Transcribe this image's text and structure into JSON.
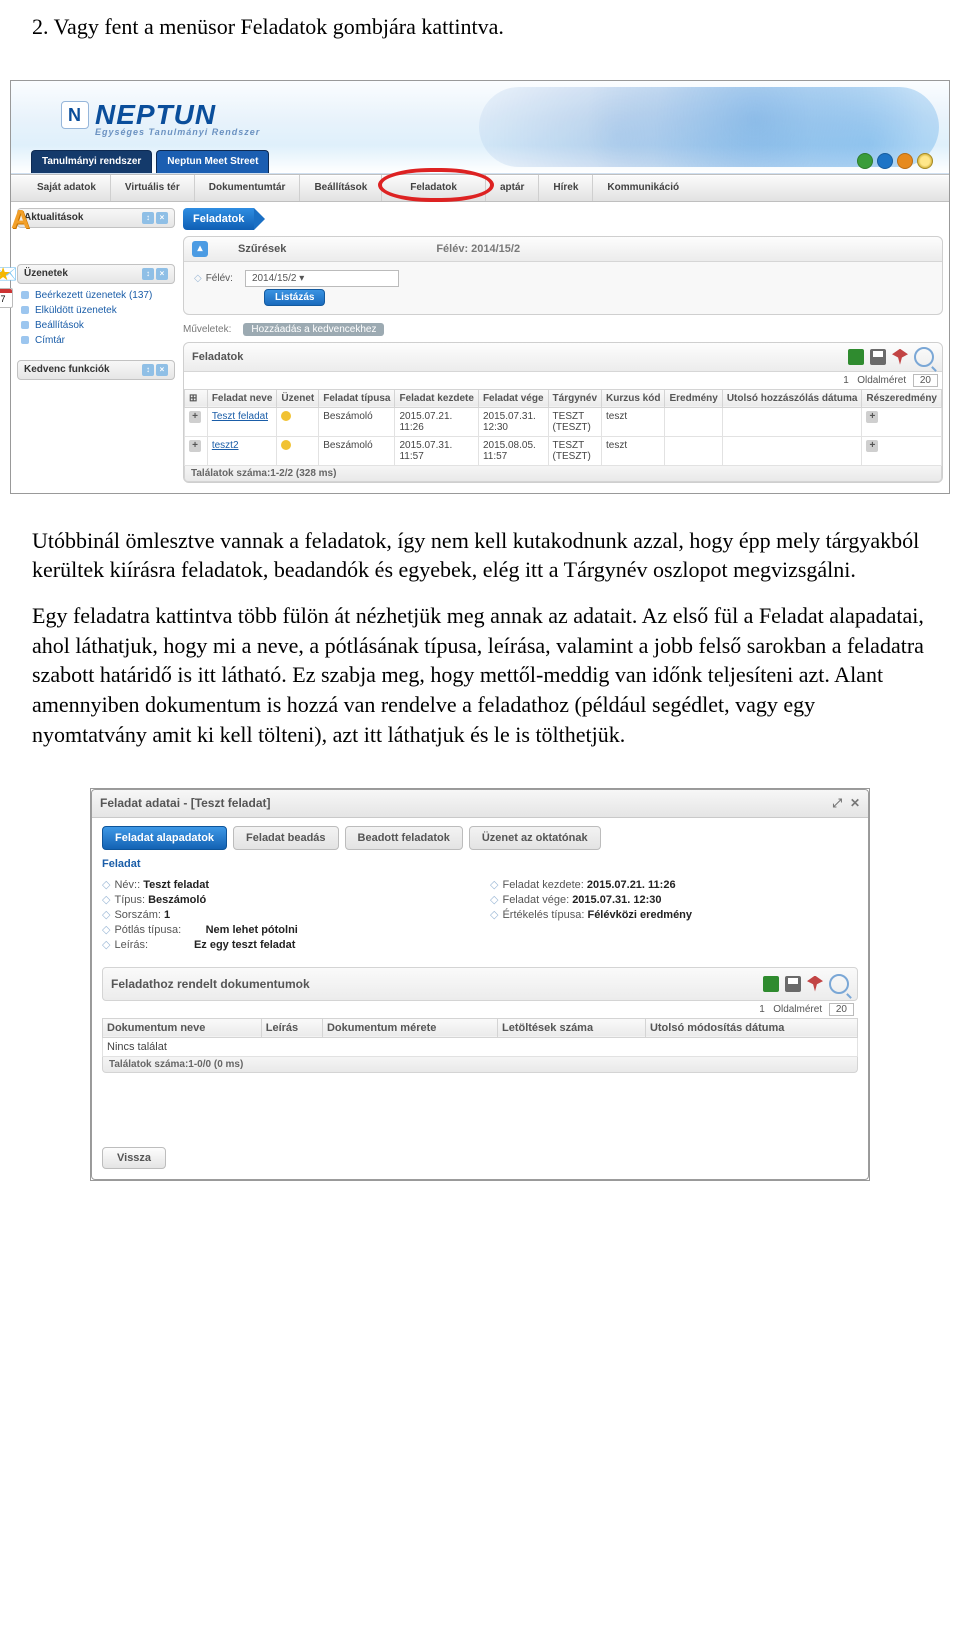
{
  "doc": {
    "heading": "2. Vagy fent a menüsor Feladatok gombjára kattintva.",
    "p1": "Utóbbinál ömlesztve vannak a feladatok, így nem kell kutakodnunk azzal, hogy épp mely tárgyakból kerültek kiírásra feladatok, beadandók és egyebek, elég itt a Tárgynév oszlopot megvizsgálni.",
    "p2": "Egy feladatra kattintva több fülön át nézhetjük meg annak az adatait. Az első fül a Feladat alapadatai, ahol láthatjuk, hogy mi a neve, a pótlásának típusa, leírása, valamint a jobb felső sarokban a feladatra szabott határidő is itt látható. Ez szabja meg, hogy mettől-meddig van időnk teljesíteni azt. Alant amennyiben dokumentum is hozzá van rendelve a feladathoz (például segédlet, vagy egy nyomtatvány amit ki kell tölteni), azt itt láthatjuk és le is tölthetjük."
  },
  "neptun": {
    "brand": "NEPTUN",
    "brand_sub": "Egységes Tanulmányi Rendszer",
    "top_tabs": [
      "Tanulmányi rendszer",
      "Neptun Meet Street"
    ],
    "menu": [
      "Saját adatok",
      "Virtuális tér",
      "Dokumentumtár",
      "Beállítások",
      "Feladatok",
      "aptár",
      "Hírek",
      "Kommunikáció"
    ],
    "side": {
      "akt": "Aktualitások",
      "uzen": "Üzenetek",
      "uzen_items": [
        "Beérkezett üzenetek (137)",
        "Elküldött üzenetek",
        "Beállítások",
        "Címtár"
      ],
      "fav": "Kedvenc funkciók",
      "cal_day": "7"
    },
    "main": {
      "crumb": "Feladatok",
      "filter_title": "Szűrések",
      "filter_right": "Félév: 2014/15/2",
      "felev_label": "Félév:",
      "felev_value": "2014/15/2",
      "list_btn": "Listázás",
      "ops_label": "Műveletek:",
      "ops_link": "Hozzáadás a kedvencekhez",
      "grid_title": "Feladatok",
      "page_size_label": "Oldalméret",
      "page_size_value": "20",
      "page_indicator": "1",
      "columns": [
        "",
        "Feladat neve",
        "Üzenet",
        "Feladat típusa",
        "Feladat kezdete",
        "Feladat vége",
        "Tárgynév",
        "Kurzus kód",
        "Eredmény",
        "Utolsó hozzászólás dátuma",
        "Részeredmény"
      ],
      "rows": [
        {
          "name": "Teszt feladat",
          "type": "Beszámoló",
          "start": "2015.07.21. 11:26",
          "end": "2015.07.31. 12:30",
          "subj": "TESZT (TESZT)",
          "course": "teszt"
        },
        {
          "name": "teszt2",
          "type": "Beszámoló",
          "start": "2015.07.31. 11:57",
          "end": "2015.08.05. 11:57",
          "subj": "TESZT (TESZT)",
          "course": "teszt"
        }
      ],
      "results": "Találatok száma:1-2/2 (328 ms)"
    }
  },
  "detail": {
    "title": "Feladat adatai - [Teszt feladat]",
    "tabs": [
      "Feladat alapadatok",
      "Feladat beadás",
      "Beadott feladatok",
      "Üzenet az oktatónak"
    ],
    "section": "Feladat",
    "left": {
      "name_l": "Név::",
      "name_v": "Teszt feladat",
      "type_l": "Típus:",
      "type_v": "Beszámoló",
      "sor_l": "Sorszám:",
      "sor_v": "1",
      "pot_l": "Pótlás típusa:",
      "pot_v": "Nem lehet pótolni",
      "leir_l": "Leírás:",
      "leir_v": "Ez egy teszt feladat"
    },
    "right": {
      "start_l": "Feladat kezdete:",
      "start_v": "2015.07.21. 11:26",
      "end_l": "Feladat vége:",
      "end_v": "2015.07.31. 12:30",
      "ert_l": "Értékelés típusa:",
      "ert_v": "Félévközi eredmény"
    },
    "docs_title": "Feladathoz rendelt dokumentumok",
    "page_size_label": "Oldalméret",
    "page_size_value": "20",
    "page_indicator": "1",
    "doc_cols": [
      "Dokumentum neve",
      "Leírás",
      "Dokumentum mérete",
      "Letöltések száma",
      "Utolsó módosítás dátuma"
    ],
    "empty": "Nincs találat",
    "results": "Találatok száma:1-0/0 (0 ms)",
    "back": "Vissza"
  }
}
